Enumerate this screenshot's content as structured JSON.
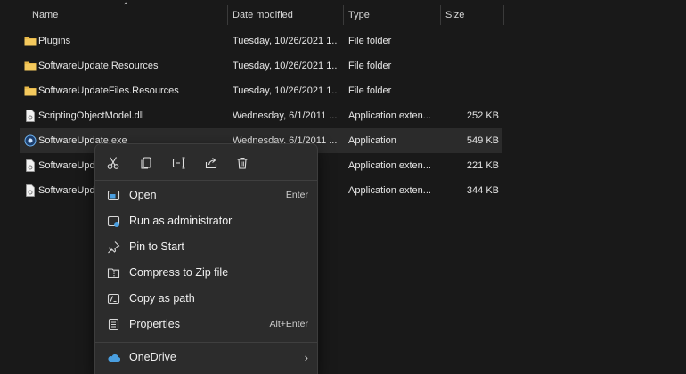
{
  "columns": {
    "name": "Name",
    "date": "Date modified",
    "type": "Type",
    "size": "Size"
  },
  "files": [
    {
      "name": "Plugins",
      "date": "Tuesday, 10/26/2021 1...",
      "type": "File folder",
      "size": "",
      "icon": "folder-icon"
    },
    {
      "name": "SoftwareUpdate.Resources",
      "date": "Tuesday, 10/26/2021 1...",
      "type": "File folder",
      "size": "",
      "icon": "folder-icon"
    },
    {
      "name": "SoftwareUpdateFiles.Resources",
      "date": "Tuesday, 10/26/2021 1...",
      "type": "File folder",
      "size": "",
      "icon": "folder-icon"
    },
    {
      "name": "ScriptingObjectModel.dll",
      "date": "Wednesday, 6/1/2011 ...",
      "type": "Application exten...",
      "size": "252 KB",
      "icon": "dll-file-icon"
    },
    {
      "name": "SoftwareUpdate.exe",
      "date": "Wednesday, 6/1/2011 ...",
      "type": "Application",
      "size": "549 KB",
      "icon": "exe-file-icon"
    },
    {
      "name": "SoftwareUpd",
      "date": "",
      "type": "Application exten...",
      "size": "221 KB",
      "icon": "dll-file-icon"
    },
    {
      "name": "SoftwareUpd",
      "date": "",
      "type": "Application exten...",
      "size": "344 KB",
      "icon": "dll-file-icon"
    }
  ],
  "context_menu": {
    "quick_actions": [
      "cut-icon",
      "copy-icon",
      "rename-icon",
      "share-icon",
      "delete-icon"
    ],
    "items": [
      {
        "label": "Open",
        "shortcut": "Enter",
        "icon": "open-icon"
      },
      {
        "label": "Run as administrator",
        "shortcut": "",
        "icon": "shield-icon"
      },
      {
        "label": "Pin to Start",
        "shortcut": "",
        "icon": "pin-icon"
      },
      {
        "label": "Compress to Zip file",
        "shortcut": "",
        "icon": "zip-icon"
      },
      {
        "label": "Copy as path",
        "shortcut": "",
        "icon": "path-icon"
      },
      {
        "label": "Properties",
        "shortcut": "Alt+Enter",
        "icon": "properties-icon"
      },
      {
        "label": "OneDrive",
        "shortcut": "",
        "icon": "onedrive-icon"
      }
    ]
  },
  "colors": {
    "background": "#191919",
    "selected_row": "#2b2b2b",
    "menu_bg": "#2c2c2c",
    "folder": "#e8b949",
    "accent_blue": "#4a9fe0"
  }
}
